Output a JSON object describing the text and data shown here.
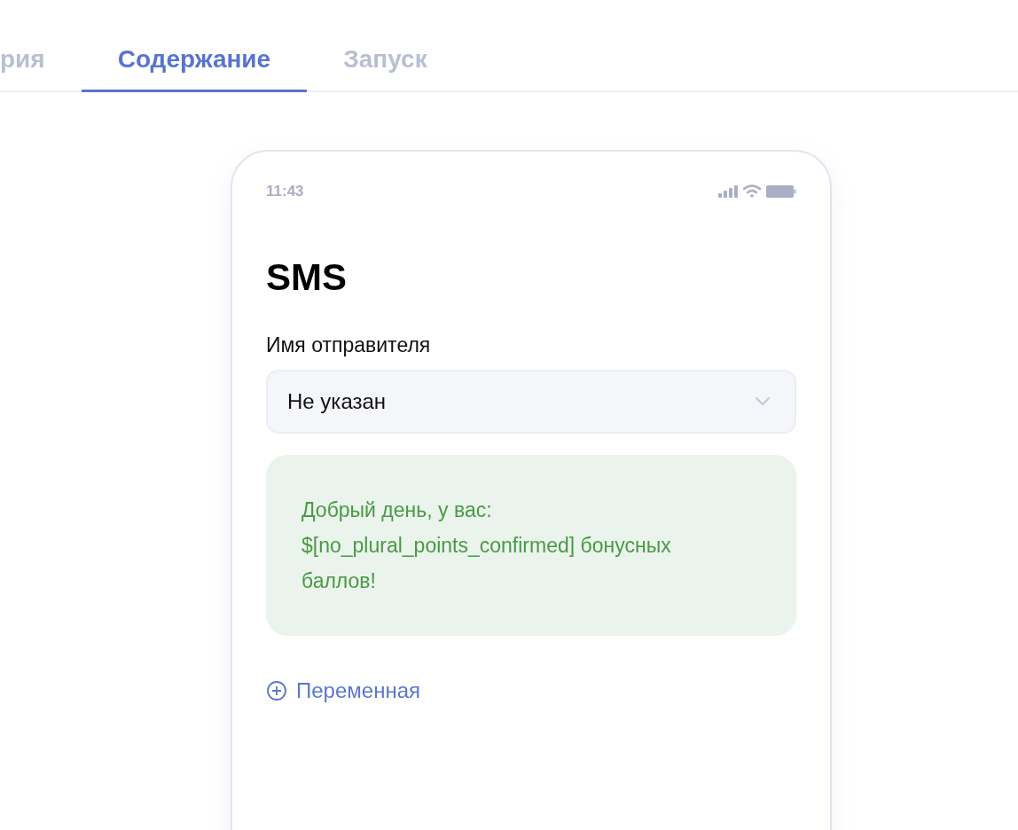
{
  "tabs": [
    {
      "label": "рия",
      "selected": false
    },
    {
      "label": "Содержание",
      "selected": true
    },
    {
      "label": "Запуск",
      "selected": false
    }
  ],
  "phone": {
    "time": "11:43",
    "title": "SMS",
    "sender_label": "Имя отправителя",
    "sender_select": {
      "value": "Не указан"
    },
    "message": "Добрый день, у вас: $[no_plural_points_confirmed] бонусных баллов!",
    "add_variable": "Переменная"
  }
}
